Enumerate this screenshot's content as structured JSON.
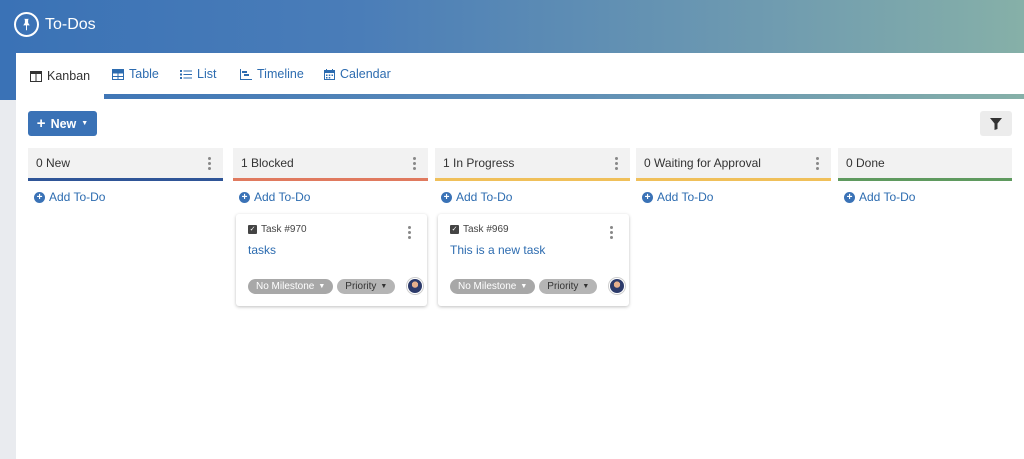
{
  "app": {
    "title": "To-Dos"
  },
  "tabs": [
    {
      "label": "Kanban",
      "icon": "kanban-icon",
      "active": true
    },
    {
      "label": "Table",
      "icon": "table-icon"
    },
    {
      "label": "List",
      "icon": "list-icon"
    },
    {
      "label": "Timeline",
      "icon": "timeline-icon"
    },
    {
      "label": "Calendar",
      "icon": "calendar-icon"
    }
  ],
  "toolbar": {
    "new_label": "New"
  },
  "columns": [
    {
      "title": "0 New",
      "color": "#2f5597",
      "add_label": "Add To-Do"
    },
    {
      "title": "1 Blocked",
      "color": "#e07a5f",
      "add_label": "Add To-Do"
    },
    {
      "title": "1 In Progress",
      "color": "#f0c05a",
      "add_label": "Add To-Do"
    },
    {
      "title": "0 Waiting for Approval",
      "color": "#f0c05a",
      "add_label": "Add To-Do"
    },
    {
      "title": "0 Done",
      "color": "#5f9a5f",
      "add_label": "Add To-Do"
    }
  ],
  "cards": [
    {
      "column": 1,
      "id": "Task #970",
      "title": "tasks",
      "milestone": "No Milestone",
      "priority": "Priority"
    },
    {
      "column": 2,
      "id": "Task #969",
      "title": "This is a new task",
      "milestone": "No Milestone",
      "priority": "Priority"
    }
  ]
}
